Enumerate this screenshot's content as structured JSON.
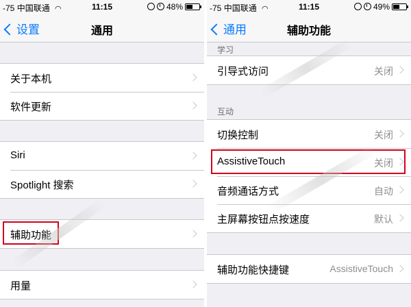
{
  "left": {
    "status": {
      "signal": "-75",
      "carrier": "中国联通",
      "time": "11:15",
      "battery": "48%",
      "battery_level": 0.48
    },
    "nav": {
      "back": "设置",
      "title": "通用"
    },
    "groups": [
      [
        "关于本机",
        "软件更新"
      ],
      [
        "Siri",
        "Spotlight 搜索"
      ],
      [
        "辅助功能"
      ],
      [
        "用量"
      ]
    ]
  },
  "right": {
    "status": {
      "signal": "-75",
      "carrier": "中国联通",
      "time": "11:15",
      "battery": "49%",
      "battery_level": 0.49
    },
    "nav": {
      "back": "通用",
      "title": "辅助功能"
    },
    "sections": {
      "learn": "学习",
      "interact": "互动"
    },
    "learn_rows": [
      {
        "label": "引导式访问",
        "value": "关闭"
      }
    ],
    "interact_rows": [
      {
        "label": "切换控制",
        "value": "关闭"
      },
      {
        "label": "AssistiveTouch",
        "value": "关闭"
      },
      {
        "label": "音频通话方式",
        "value": "自动"
      },
      {
        "label": "主屏幕按钮点按速度",
        "value": "默认"
      }
    ],
    "shortcut_rows": [
      {
        "label": "辅助功能快捷键",
        "value": "AssistiveTouch"
      }
    ]
  },
  "icons": [
    "wifi-icon",
    "rotation-lock-icon",
    "alarm-icon",
    "battery-icon",
    "back-chevron-icon",
    "chevron-right-icon"
  ],
  "colors": {
    "accent": "#0a7bfb",
    "highlight": "#d0021b",
    "background": "#efeff4"
  }
}
